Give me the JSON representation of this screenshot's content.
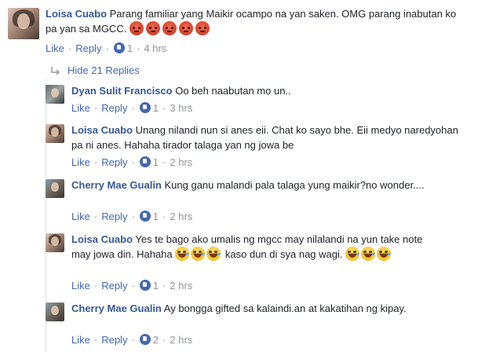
{
  "comments": [
    {
      "author": "Loisa Cuabo",
      "text": "Parang familiar yang Maikir ocampo na yan saken. OMG parang inabutan ko pa yan sa MGCC.",
      "like_label": "Like",
      "reply_label": "Reply",
      "like_count": "1",
      "time": "4 hrs",
      "emojis": [
        "angry-emoji",
        "angry-emoji",
        "angry-emoji",
        "angry-emoji",
        "angry-emoji"
      ]
    }
  ],
  "hide_replies_label": "Hide 21 Replies",
  "replies": [
    {
      "author": "Dyan Sulit Francisco",
      "text": "Oo beh naabutan mo un..",
      "like_label": "Like",
      "reply_label": "Reply",
      "like_count": "1",
      "time": "3 hrs"
    },
    {
      "author": "Loisa Cuabo",
      "text": "Unang nilandi nun si anes eii. Chat ko sayo bhe. Eii medyo naredyohan pa ni anes. Hahaha tirador talaga yan ng jowa be",
      "like_label": "Like",
      "reply_label": "Reply",
      "like_count": "1",
      "time": "2 hrs"
    },
    {
      "author": "Cherry Mae Gualin",
      "text": "Kung ganu malandi pala talaga yung maikir?no wonder....",
      "like_label": "Like",
      "reply_label": "Reply",
      "like_count": "1",
      "time": "2 hrs"
    },
    {
      "author": "Loisa Cuabo",
      "text_a": "Yes te bago ako umalis ng mgcc may nilalandi na yun take note may jowa din. Hahaha",
      "text_b": "kaso dun di sya nag wagi.",
      "like_label": "Like",
      "reply_label": "Reply",
      "like_count": "1",
      "time": "2 hrs"
    },
    {
      "author": "Cherry Mae Gualin",
      "text": "Ay bongga gifted sa kalaindi.an at kakatihan ng kipay.",
      "like_label": "Like",
      "reply_label": "Reply",
      "like_count": "2",
      "time": "2 hrs"
    }
  ],
  "colors": {
    "author": "#365899",
    "link": "#4267b2",
    "meta": "#90949c",
    "text": "#1d2129"
  }
}
